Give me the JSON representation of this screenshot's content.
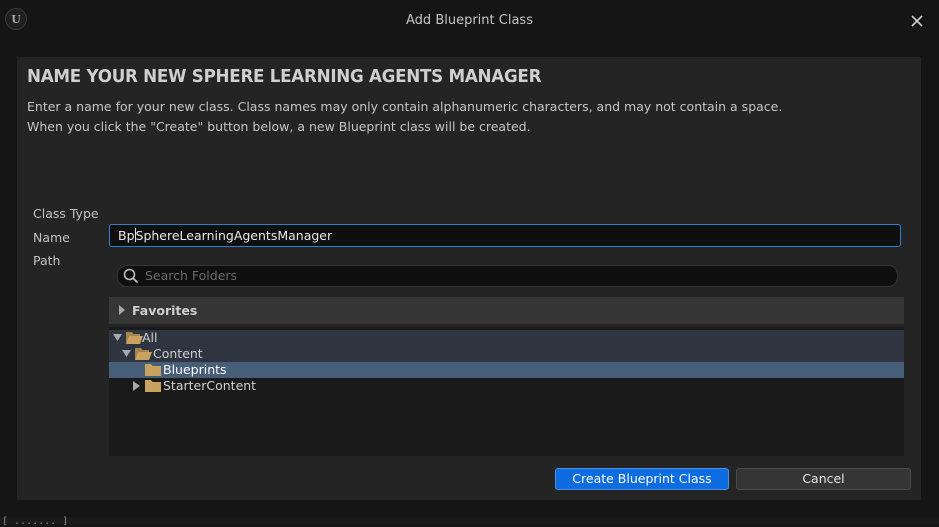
{
  "window": {
    "title": "Add Blueprint Class",
    "logo_text": "U"
  },
  "dialog": {
    "heading": "NAME YOUR NEW SPHERE LEARNING AGENTS MANAGER",
    "description_line1": "Enter a name for your new class. Class names may only contain alphanumeric characters, and may not contain a space.",
    "description_line2": "When you click the \"Create\" button below, a new Blueprint class will be created."
  },
  "form": {
    "class_type_label": "Class Type",
    "name_label": "Name",
    "path_label": "Path",
    "name_value_before_caret": "Bp",
    "name_value_after_caret": "SphereLearningAgentsManager"
  },
  "folders": {
    "search_placeholder": "Search Folders",
    "favorites_label": "Favorites",
    "tree": [
      {
        "label": "All",
        "icon": "folder-open-icon",
        "expanded": true
      },
      {
        "label": "Content",
        "icon": "folder-open-icon",
        "expanded": true
      },
      {
        "label": "Blueprints",
        "icon": "folder-icon",
        "selected": true
      },
      {
        "label": "StarterContent",
        "icon": "folder-icon",
        "expanded": false
      }
    ]
  },
  "buttons": {
    "create": "Create Blueprint Class",
    "cancel": "Cancel"
  },
  "background": {
    "terminal_fragment": "[ ....... ]"
  },
  "colors": {
    "accent": "#0d6de0",
    "input_focus": "#2f7fd0",
    "selected_row": "#465e78",
    "folder": "#c9a25e"
  }
}
